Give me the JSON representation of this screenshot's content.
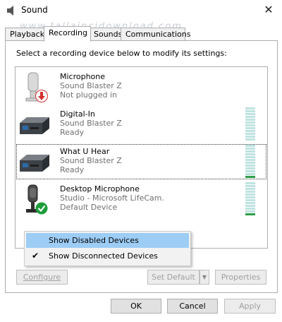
{
  "window": {
    "title": "Sound",
    "close_glyph": "✕",
    "watermark": "www.tallaincidownload.com"
  },
  "tabs": [
    {
      "label": "Playback",
      "active": false
    },
    {
      "label": "Recording",
      "active": true
    },
    {
      "label": "Sounds",
      "active": false
    },
    {
      "label": "Communications",
      "active": false
    }
  ],
  "instruction": "Select a recording device below to modify its settings:",
  "devices": [
    {
      "name": "Microphone",
      "line1": "Sound Blaster Z",
      "line2": "Not plugged in",
      "icon": "microphone-icon",
      "status_icon": "unplugged-arrow-icon"
    },
    {
      "name": "Digital-In",
      "line1": "Sound Blaster Z",
      "line2": "Ready",
      "icon": "soundcard-icon",
      "level": 0
    },
    {
      "name": "What U Hear",
      "line1": "Sound Blaster Z",
      "line2": "Ready",
      "icon": "soundcard-icon",
      "level": 0.1
    },
    {
      "name": "Desktop Microphone",
      "line1": "Studio - Microsoft LifeCam.",
      "line2": "Default Device",
      "icon": "desktop-microphone-icon",
      "status_icon": "default-check-icon",
      "level": 0.1
    }
  ],
  "context_menu": {
    "items": [
      {
        "label": "Show Disabled Devices",
        "checked": false,
        "highlighted": true
      },
      {
        "label": "Show Disconnected Devices",
        "checked": true,
        "highlighted": false
      }
    ],
    "check_glyph": "✔"
  },
  "panel_buttons": {
    "configure": "Configure",
    "set_default": "Set Default",
    "properties": "Properties"
  },
  "dialog_buttons": {
    "ok": "OK",
    "cancel": "Cancel",
    "apply": "Apply"
  },
  "colors": {
    "highlight": "#9dcdf5",
    "meter_green": "#2f9e49",
    "meter_empty": "#bfe3e0",
    "unplugged_red": "#d32f2f",
    "default_green": "#1e9e3b"
  }
}
